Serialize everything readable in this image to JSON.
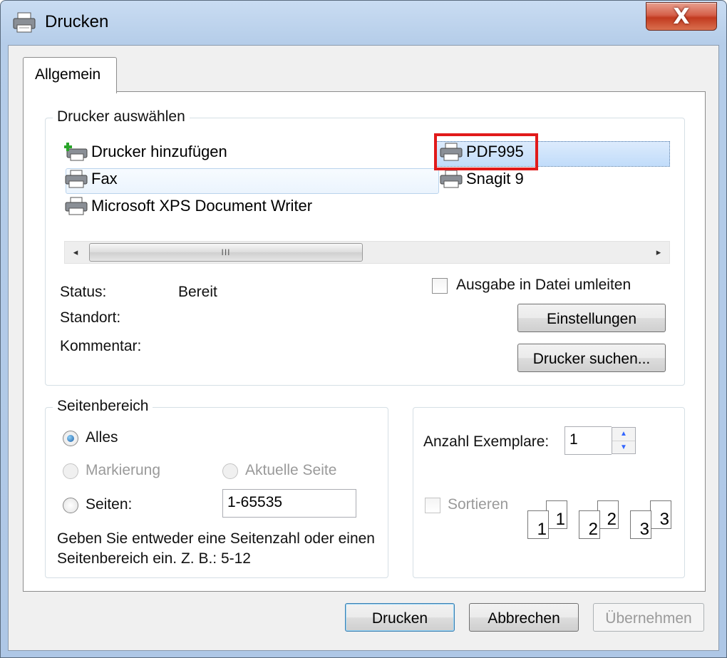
{
  "window": {
    "title": "Drucken",
    "close_glyph": "X"
  },
  "tabs": [
    {
      "label": "Allgemein"
    }
  ],
  "printer_group": {
    "label": "Drucker auswählen",
    "printers": [
      {
        "name": "Drucker hinzufügen",
        "icon": "add-printer-icon"
      },
      {
        "name": "Fax",
        "icon": "printer-icon"
      },
      {
        "name": "Microsoft XPS Document Writer",
        "icon": "printer-icon"
      },
      {
        "name": "PDF995",
        "icon": "printer-icon",
        "selected": true
      },
      {
        "name": "Snagit 9",
        "icon": "printer-icon"
      }
    ],
    "scroll": {
      "left_glyph": "◂",
      "right_glyph": "▸",
      "thumb_grip": "III"
    },
    "status_label": "Status:",
    "status_value": "Bereit",
    "location_label": "Standort:",
    "comment_label": "Kommentar:",
    "print_to_file_label": "Ausgabe in Datei umleiten",
    "print_to_file_checked": false,
    "settings_button": "Einstellungen",
    "find_printer_button": "Drucker suchen..."
  },
  "page_range": {
    "label": "Seitenbereich",
    "all_label": "Alles",
    "selection_label": "Markierung",
    "current_page_label": "Aktuelle Seite",
    "pages_label": "Seiten:",
    "pages_value": "1-65535",
    "hint": "Geben Sie entweder eine Seitenzahl oder einen Seitenbereich ein. Z. B.: 5-12",
    "selected_option": "Alles"
  },
  "copies": {
    "label": "Anzahl Exemplare:",
    "value": "1",
    "collate_label": "Sortieren",
    "collate_checked": false,
    "collate_sets": [
      {
        "back": "1",
        "front": "1"
      },
      {
        "back": "2",
        "front": "2"
      },
      {
        "back": "3",
        "front": "3"
      }
    ]
  },
  "buttons": {
    "print": "Drucken",
    "cancel": "Abbrechen",
    "apply": "Übernehmen"
  },
  "colors": {
    "highlight_box": "#e11a1a",
    "selection": "#c1dcfa",
    "close_button": "#c23a1f"
  }
}
